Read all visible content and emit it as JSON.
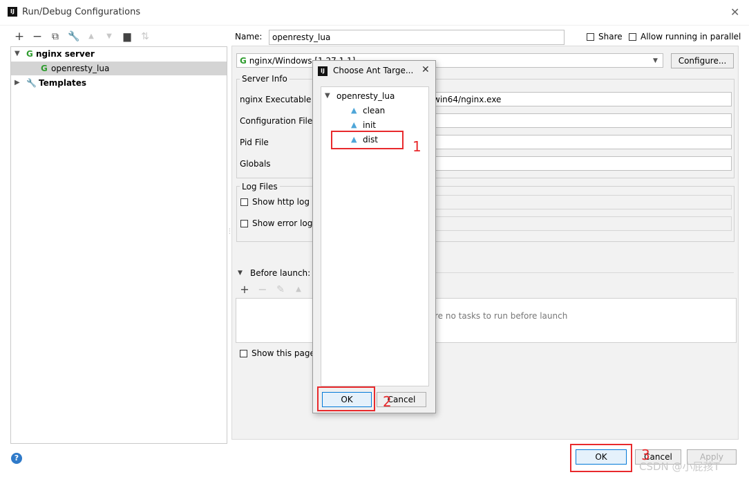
{
  "window": {
    "title": "Run/Debug Configurations",
    "app_icon": "IJ"
  },
  "toolbar": {
    "icons": [
      "plus-icon",
      "minus-icon",
      "copy-icon",
      "wrench-icon",
      "arrow-up-icon",
      "arrow-down-icon",
      "new-folder-icon",
      "sort-icon"
    ]
  },
  "tree": {
    "nginx_server": "nginx server",
    "openresty_lua": "openresty_lua",
    "templates": "Templates"
  },
  "form": {
    "name_label": "Name:",
    "name_value": "openresty_lua",
    "share_label": "Share",
    "parallel_label": "Allow running in parallel",
    "nginx_select": "nginx/Windows [1.27.1.1]",
    "configure_button": "Configure...",
    "server_info_legend": "Server Info",
    "nginx_executable_label": "nginx Executable",
    "nginx_executable_value": "win64/nginx.exe",
    "configuration_file_label": "Configuration File",
    "pid_file_label": "Pid File",
    "globals_label": "Globals",
    "log_files_legend": "Log Files",
    "show_http_log": "Show http log",
    "show_error_log": "Show error log",
    "before_launch": "Before launch: Ac",
    "no_tasks": "re no tasks to run before launch",
    "show_this_page": "Show this page"
  },
  "dialog": {
    "title": "Choose Ant Targe...",
    "root": "openresty_lua",
    "targets": [
      "clean",
      "init",
      "dist"
    ],
    "ok_label": "OK",
    "cancel_label": "Cancel"
  },
  "footer": {
    "ok_label": "OK",
    "cancel_label": "Cancel",
    "apply_label": "Apply"
  },
  "annotations": {
    "num1": "1",
    "num2": "2",
    "num3": "3"
  },
  "watermark": "CSDN @小屁孩T",
  "colors": {
    "annotation_red": "#e8292c",
    "nginx_green": "#2f9c2f",
    "ant_blue": "#4fa6d8"
  }
}
